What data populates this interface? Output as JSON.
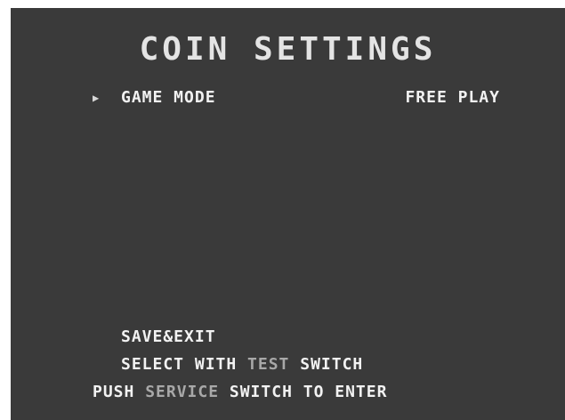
{
  "screen": {
    "title": "COIN SETTINGS",
    "menu": {
      "cursor_icon": "▶",
      "item_label": "GAME MODE",
      "item_value": "FREE PLAY"
    },
    "save_exit": "SAVE&EXIT",
    "instructions": {
      "select_prefix": "SELECT WITH ",
      "select_button": "TEST",
      "select_suffix": " SWITCH",
      "push_prefix": "PUSH ",
      "push_button": "SERVICE",
      "push_suffix": " SWITCH TO ENTER"
    }
  }
}
